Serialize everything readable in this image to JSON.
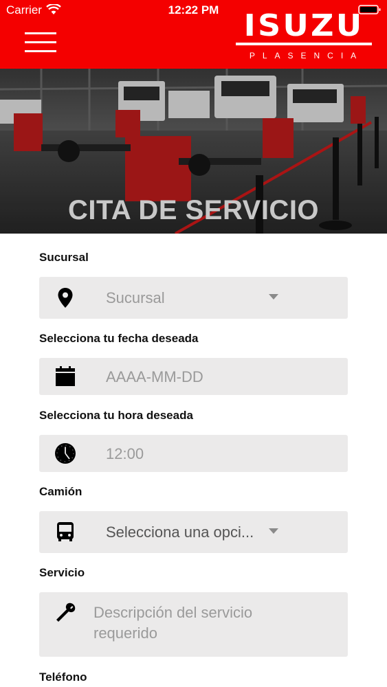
{
  "status_bar": {
    "carrier": "Carrier",
    "time": "12:22 PM"
  },
  "header": {
    "brand": "ISUZU",
    "brand_sub": "PLASENCIA",
    "background_color": "#f40000"
  },
  "hero": {
    "title": "CITA DE SERVICIO"
  },
  "form": {
    "branch": {
      "label": "Sucursal",
      "placeholder": "Sucursal",
      "icon": "map-pin-icon"
    },
    "date": {
      "label": "Selecciona tu fecha deseada",
      "placeholder": "AAAA-MM-DD",
      "icon": "calendar-icon"
    },
    "time": {
      "label": "Selecciona tu hora deseada",
      "value": "12:00",
      "icon": "clock-icon"
    },
    "truck": {
      "label": "Camión",
      "value": "Selecciona una opci...",
      "icon": "bus-icon"
    },
    "service": {
      "label": "Servicio",
      "placeholder_line1": "Descripción del servicio",
      "placeholder_line2": "requerido",
      "icon": "wrench-icon"
    },
    "phone": {
      "label": "Teléfono"
    }
  }
}
